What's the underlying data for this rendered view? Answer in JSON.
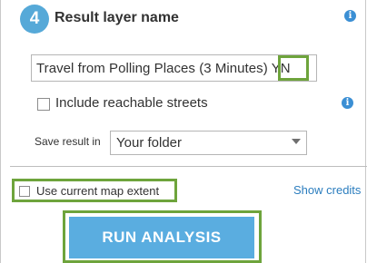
{
  "step": {
    "number": "4",
    "title": "Result layer name"
  },
  "name_input": {
    "value_prefix": "Travel from Polling Places (3 Minutes) ",
    "value_suffix": "YN"
  },
  "options": {
    "include_streets_label": "Include reachable streets",
    "include_streets_checked": false,
    "save_label": "Save result in",
    "save_value": "Your folder",
    "extent_label": "Use current map extent",
    "extent_checked": false,
    "credits_link": "Show credits"
  },
  "actions": {
    "run_label": "RUN ANALYSIS"
  },
  "colors": {
    "accent": "#56a9d8",
    "button": "#5aade0",
    "highlight": "#6ea43c",
    "link": "#2b7dbe",
    "info": "#3b8fd4"
  },
  "icons": {
    "info": "info-icon",
    "dropdown": "chevron-down-icon"
  }
}
